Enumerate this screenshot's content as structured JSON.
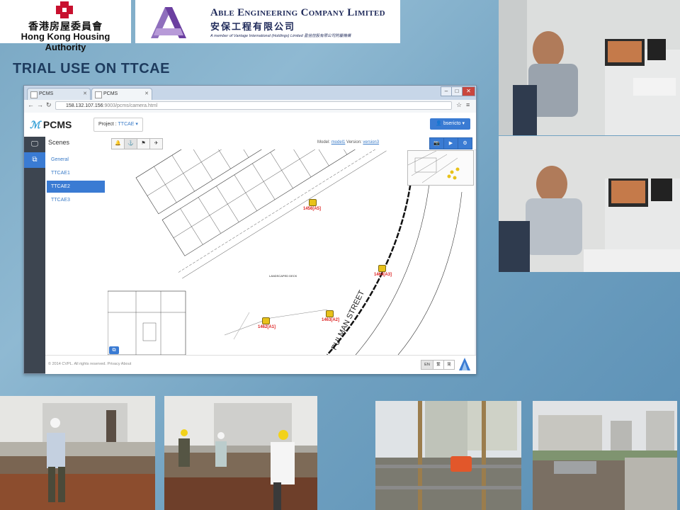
{
  "logos": {
    "hkha": {
      "name_zh": "香港房屋委員會",
      "name_en": "Hong Kong Housing Authority",
      "color": "#c8102e"
    },
    "able": {
      "name_en": "Able Engineering Company Limited",
      "name_zh": "安保工程有限公司",
      "tagline": "A member of Vantage International (Holdings) Limited 盈信控股有限公司附屬機構",
      "color": "#6b3fa0"
    }
  },
  "slide": {
    "title": "TRIAL USE ON TTCAE"
  },
  "browser": {
    "tabs": [
      {
        "label": "PCMS"
      },
      {
        "label": "PCMS"
      }
    ],
    "window_buttons": [
      "–",
      "□",
      "✕"
    ],
    "url_host": "158.132.107.156",
    "url_path": ":9003/pcms/camera.html",
    "menu_icon": "≡"
  },
  "app": {
    "logo_prefix": "ℳ",
    "logo_text": "PCMS",
    "project_label": "Project :",
    "project_value": "TTCAE ▾",
    "user_label": "👤 bsericto ▾",
    "scenes_header": "Scenes",
    "scenes": [
      "General",
      "TTCAE1",
      "TTCAE2",
      "TTCAE3"
    ],
    "selected_scene": "TTCAE2",
    "toolbar_icons": [
      "bell-icon",
      "anchor-icon",
      "flag-icon",
      "plane-icon"
    ],
    "model_prefix": "Model:",
    "model_value": "model1",
    "version_prefix": "Version:",
    "version_value": "version3",
    "view_buttons": [
      "📷",
      "▶",
      "⚙"
    ],
    "footer_text": "© 2014 CVPL. All rights reserved.   Privacy   About",
    "lang_buttons": [
      "EN",
      "繁",
      "简"
    ],
    "accent_color": "#3a7bd3"
  },
  "drawing": {
    "street_label": "PUI MAN STREET",
    "deck_label": "LANDSCAPED DECK",
    "cameras": [
      "1456[A5]",
      "1464[A3]",
      "1462[A1]",
      "1463[A2]"
    ]
  }
}
